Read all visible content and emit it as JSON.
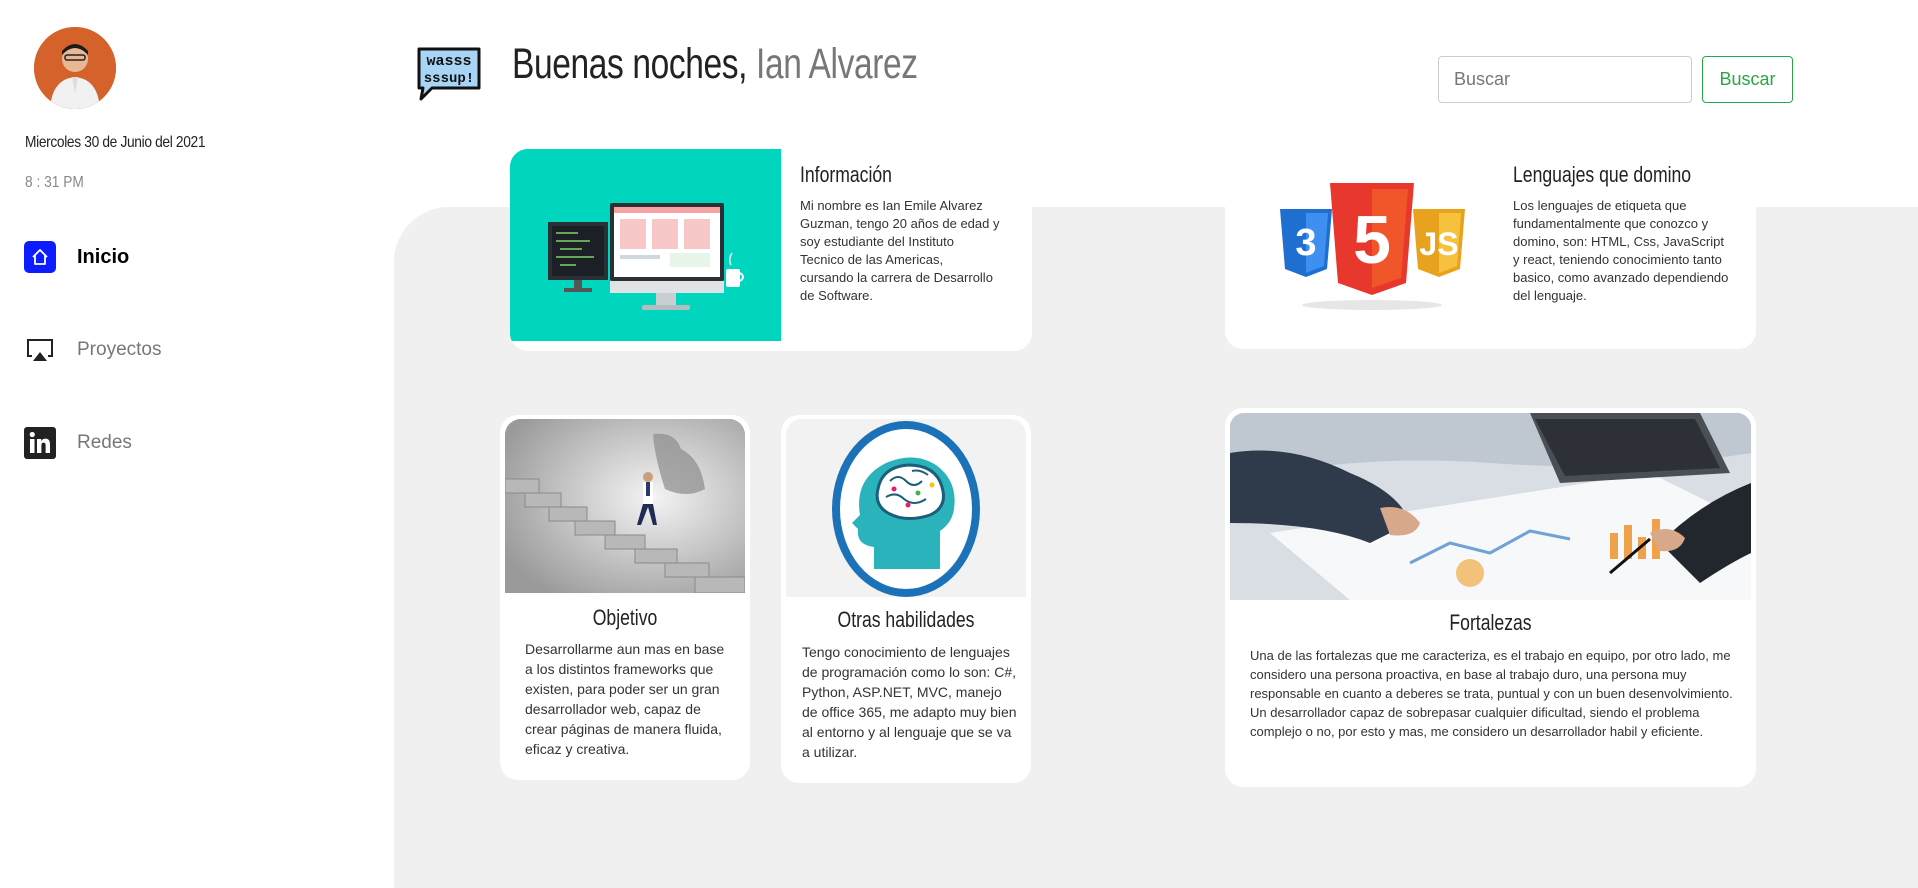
{
  "sidebar": {
    "avatar_alt": "Ian Alvarez",
    "date": "Miercoles 30 de Junio del 2021",
    "time": "8 : 31 PM",
    "nav": [
      {
        "label": "Inicio",
        "icon": "home-icon",
        "active": true
      },
      {
        "label": "Proyectos",
        "icon": "airplay-icon",
        "active": false
      },
      {
        "label": "Redes",
        "icon": "linkedin-icon",
        "active": false
      }
    ]
  },
  "header": {
    "logo_text_1": "wasss",
    "logo_text_2": "sssup!",
    "greeting": "Buenas noches,",
    "name": "Ian Alvarez",
    "search_placeholder": "Buscar",
    "search_button": "Buscar"
  },
  "cards": {
    "info": {
      "title": "Información",
      "text": "Mi nombre es Ian Emile Alvarez Guzman, tengo 20 años de edad y soy estudiante del Instituto Tecnico de las Americas, cursando la carrera de Desarrollo de Software."
    },
    "lang": {
      "title": "Lenguajes que domino",
      "text": "Los lenguajes de etiqueta que fundamentalmente que conozco y domino, son: HTML, Css, JavaScript y react, teniendo conocimiento tanto basico, como avanzado dependiendo del lenguaje."
    },
    "objetivo": {
      "title": "Objetivo",
      "text": "Desarrollarme aun mas en base a los distintos frameworks que existen, para poder ser un gran desarrollador web, capaz de crear páginas de manera fluida, eficaz y creativa."
    },
    "otras": {
      "title": "Otras habilidades",
      "text": "Tengo conocimiento de lenguajes de programación como lo son: C#, Python, ASP.NET, MVC, manejo de office 365, me adapto muy bien al entorno y al lenguaje que se va a utilizar."
    },
    "fortalezas": {
      "title": "Fortalezas",
      "text": "Una de las fortalezas que me caracteriza, es el trabajo en equipo, por otro lado, me considero una persona proactiva, en base al trabajo duro, una persona muy responsable en cuanto a deberes se trata, puntual y con un buen desenvolvimiento. Un desarrollador capaz de sobrepasar cualquier dificultad, siendo el problema complejo o no, por esto y mas, me considero un desarrollador habil y eficiente."
    }
  },
  "colors": {
    "accent_nav": "#0d1bff",
    "search_green": "#28a745",
    "info_bg": "#00d5bd",
    "main_bg": "#f0f0f0"
  }
}
